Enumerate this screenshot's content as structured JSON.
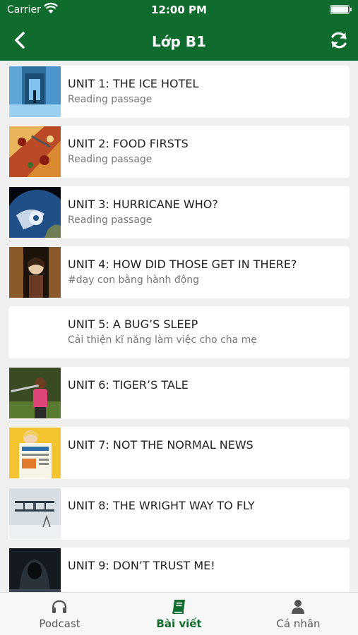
{
  "status_bar": {
    "carrier": "Carrier",
    "time": "12:00 PM"
  },
  "header": {
    "title": "Lớp B1",
    "back_icon": "chevron-left-icon",
    "refresh_icon": "refresh-icon"
  },
  "colors": {
    "primary": "#106b2e",
    "background": "#efefef",
    "card": "#ffffff"
  },
  "units": [
    {
      "title": "UNIT 1: THE ICE HOTEL",
      "subtitle": "Reading passage"
    },
    {
      "title": "UNIT 2: FOOD FIRSTS",
      "subtitle": "Reading passage"
    },
    {
      "title": "UNIT 3: HURRICANE WHO?",
      "subtitle": "Reading passage"
    },
    {
      "title": "UNIT 4: HOW DID THOSE GET IN THERE?",
      "subtitle": "#dạy con bằng hành động"
    },
    {
      "title": "UNIT 5: A BUG’S SLEEP",
      "subtitle": "Cải thiện kĩ năng làm việc cho cha mẹ"
    },
    {
      "title": "UNIT 6: TIGER’S TALE",
      "subtitle": ""
    },
    {
      "title": "UNIT 7: NOT THE NORMAL NEWS",
      "subtitle": ""
    },
    {
      "title": "UNIT 8: THE WRIGHT WAY TO FLY",
      "subtitle": ""
    },
    {
      "title": "UNIT 9: DON’T TRUST ME!",
      "subtitle": ""
    }
  ],
  "tabbar": {
    "items": [
      {
        "label": "Podcast",
        "icon": "headphones-icon",
        "active": false
      },
      {
        "label": "Bài viết",
        "icon": "book-icon",
        "active": true
      },
      {
        "label": "Cá nhân",
        "icon": "user-icon",
        "active": false
      }
    ]
  }
}
